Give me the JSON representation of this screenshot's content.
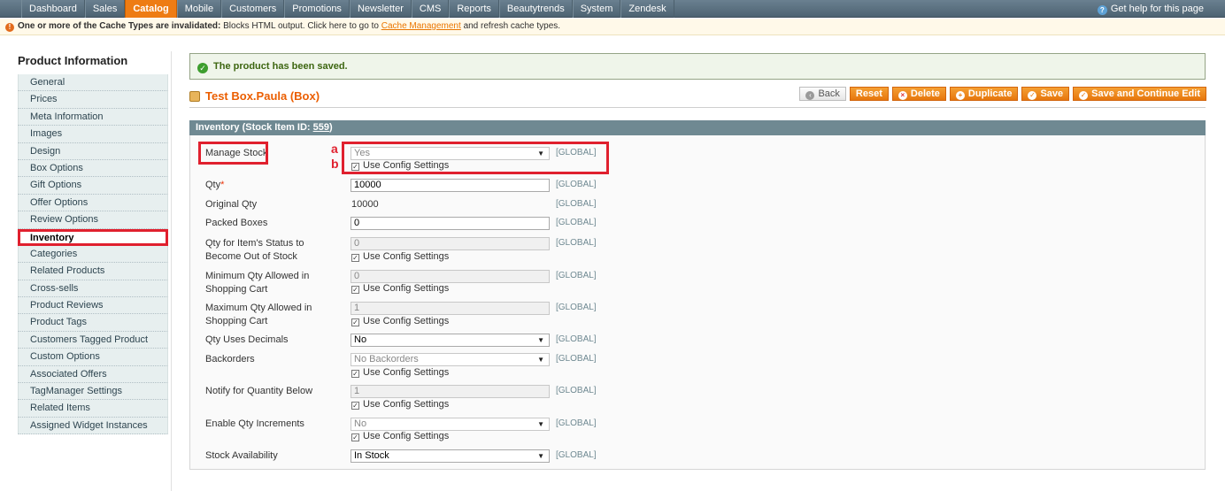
{
  "topnav": {
    "items": [
      "Dashboard",
      "Sales",
      "Catalog",
      "Mobile",
      "Customers",
      "Promotions",
      "Newsletter",
      "CMS",
      "Reports",
      "Beautytrends",
      "System",
      "Zendesk"
    ],
    "help": "Get help for this page"
  },
  "notice": {
    "bold": "One or more of the Cache Types are invalidated:",
    "text": "Blocks HTML output. Click here to go to",
    "link": "Cache Management",
    "tail": "and refresh cache types."
  },
  "sidebar": {
    "title": "Product Information",
    "items": [
      "General",
      "Prices",
      "Meta Information",
      "Images",
      "Design",
      "Box Options",
      "Gift Options",
      "Offer Options",
      "Review Options",
      "Inventory",
      "Categories",
      "Related Products",
      "Cross-sells",
      "Product Reviews",
      "Product Tags",
      "Customers Tagged Product",
      "Custom Options",
      "Associated Offers",
      "TagManager Settings",
      "Related Items",
      "Assigned Widget Instances"
    ],
    "active": "Inventory"
  },
  "success": "The product has been saved.",
  "product_title": "Test Box.Paula (Box)",
  "buttons": {
    "back": "Back",
    "reset": "Reset",
    "delete": "Delete",
    "duplicate": "Duplicate",
    "save": "Save",
    "save_continue": "Save and Continue Edit"
  },
  "fieldset": {
    "title_prefix": "Inventory (Stock Item ID: ",
    "stock_id": "559",
    "title_suffix": ")"
  },
  "scope": "[GLOBAL]",
  "config_label": "Use Config Settings",
  "annotations": {
    "a": "a",
    "b": "b"
  },
  "fields": {
    "manage_stock": {
      "label": "Manage Stock",
      "value": "Yes"
    },
    "qty": {
      "label": "Qty",
      "req": "*",
      "value": "10000"
    },
    "original_qty": {
      "label": "Original Qty",
      "value": "10000"
    },
    "packed_boxes": {
      "label": "Packed Boxes",
      "value": "0"
    },
    "out_of_stock": {
      "label": "Qty for Item's Status to Become Out of Stock",
      "value": "0"
    },
    "min_qty": {
      "label": "Minimum Qty Allowed in Shopping Cart",
      "value": "0"
    },
    "max_qty": {
      "label": "Maximum Qty Allowed in Shopping Cart",
      "value": "1"
    },
    "decimals": {
      "label": "Qty Uses Decimals",
      "value": "No"
    },
    "backorders": {
      "label": "Backorders",
      "value": "No Backorders"
    },
    "notify": {
      "label": "Notify for Quantity Below",
      "value": "1"
    },
    "increments": {
      "label": "Enable Qty Increments",
      "value": "No"
    },
    "availability": {
      "label": "Stock Availability",
      "value": "In Stock"
    }
  }
}
